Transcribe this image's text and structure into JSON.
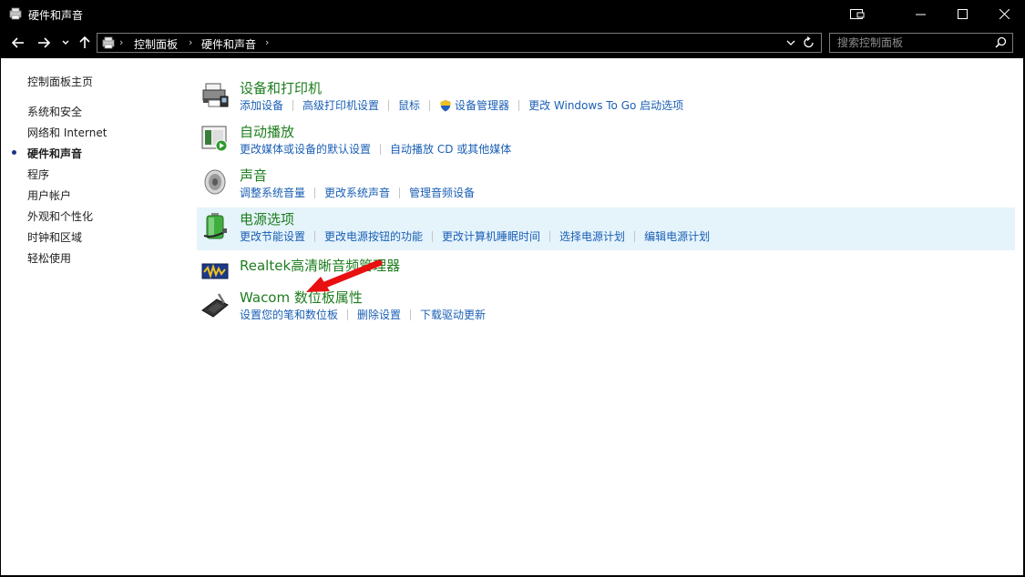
{
  "window": {
    "title": "硬件和声音"
  },
  "breadcrumb": {
    "items": [
      "控制面板",
      "硬件和声音"
    ]
  },
  "search": {
    "placeholder": "搜索控制面板"
  },
  "sidebar": {
    "home": "控制面板主页",
    "items": [
      {
        "label": "系统和安全",
        "current": false
      },
      {
        "label": "网络和 Internet",
        "current": false
      },
      {
        "label": "硬件和声音",
        "current": true
      },
      {
        "label": "程序",
        "current": false
      },
      {
        "label": "用户帐户",
        "current": false
      },
      {
        "label": "外观和个性化",
        "current": false
      },
      {
        "label": "时钟和区域",
        "current": false
      },
      {
        "label": "轻松使用",
        "current": false
      }
    ]
  },
  "categories": [
    {
      "title": "设备和打印机",
      "icon": "printer-icon",
      "tasks": [
        "添加设备",
        "高级打印机设置",
        "鼠标",
        "设备管理器",
        "更改 Windows To Go 启动选项"
      ]
    },
    {
      "title": "自动播放",
      "icon": "autoplay-icon",
      "tasks": [
        "更改媒体或设备的默认设置",
        "自动播放 CD 或其他媒体"
      ]
    },
    {
      "title": "声音",
      "icon": "speaker-icon",
      "tasks": [
        "调整系统音量",
        "更改系统声音",
        "管理音频设备"
      ]
    },
    {
      "title": "电源选项",
      "icon": "battery-icon",
      "highlighted": true,
      "tasks": [
        "更改节能设置",
        "更改电源按钮的功能",
        "更改计算机睡眠时间",
        "选择电源计划",
        "编辑电源计划"
      ]
    },
    {
      "title": "Realtek高清晰音频管理器",
      "icon": "realtek-icon",
      "tasks": []
    },
    {
      "title": "Wacom 数位板属性",
      "icon": "tablet-icon",
      "tasks": [
        "设置您的笔和数位板",
        "删除设置",
        "下载驱动更新"
      ]
    }
  ],
  "colors": {
    "category_title": "#1e7d1e",
    "task_link": "#1a5fb4",
    "highlight_bg": "#e5f3fb",
    "arrow": "#e81010"
  }
}
